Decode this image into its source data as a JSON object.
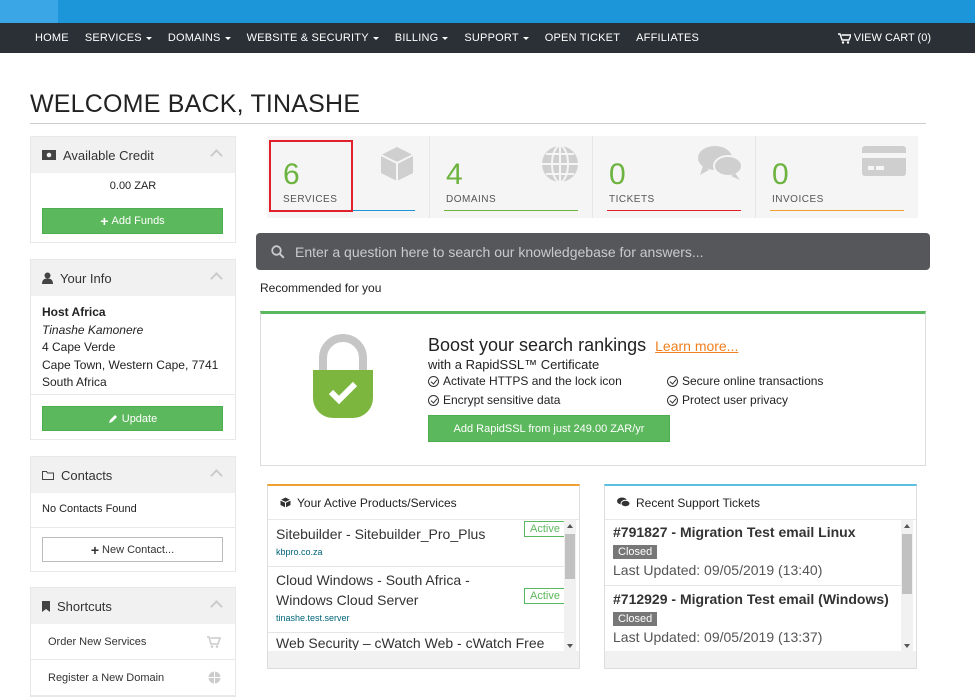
{
  "nav": {
    "items": [
      {
        "label": "HOME",
        "caret": false
      },
      {
        "label": "SERVICES",
        "caret": true
      },
      {
        "label": "DOMAINS",
        "caret": true
      },
      {
        "label": "WEBSITE & SECURITY",
        "caret": true
      },
      {
        "label": "BILLING",
        "caret": true
      },
      {
        "label": "SUPPORT",
        "caret": true
      },
      {
        "label": "OPEN TICKET",
        "caret": false
      },
      {
        "label": "AFFILIATES",
        "caret": false
      }
    ],
    "cart_label": "VIEW CART (0)"
  },
  "page_title": "WELCOME BACK, TINASHE",
  "sidebar": {
    "credit": {
      "title": "Available Credit",
      "amount": "0.00 ZAR",
      "button": "Add Funds"
    },
    "info": {
      "title": "Your Info",
      "company": "Host Africa",
      "name": "Tinashe Kamonere",
      "address1": "4 Cape Verde",
      "address2": "Cape Town, Western Cape, 7741",
      "country": "South Africa",
      "button": "Update"
    },
    "contacts": {
      "title": "Contacts",
      "empty": "No Contacts Found",
      "button": "New Contact..."
    },
    "shortcuts": {
      "title": "Shortcuts",
      "items": [
        "Order New Services",
        "Register a New Domain"
      ]
    }
  },
  "stats": [
    {
      "value": "6",
      "label": "SERVICES",
      "color": "#1c95d9",
      "icon": "cube-icon"
    },
    {
      "value": "4",
      "label": "DOMAINS",
      "color": "#6cb33f",
      "icon": "globe-icon"
    },
    {
      "value": "0",
      "label": "TICKETS",
      "color": "#e0202a",
      "icon": "chat-bubbles-icon"
    },
    {
      "value": "0",
      "label": "INVOICES",
      "color": "#f0a030",
      "icon": "credit-card-icon"
    }
  ],
  "search": {
    "placeholder": "Enter a question here to search our knowledgebase for answers..."
  },
  "recommended": {
    "label": "Recommended for you",
    "title": "Boost your search rankings",
    "link": "Learn more...",
    "subtitle": "with a RapidSSL™ Certificate",
    "features": [
      "Activate HTTPS and the lock icon",
      "Secure online transactions",
      "Encrypt sensitive data",
      "Protect user privacy"
    ],
    "cta": "Add RapidSSL from just 249.00 ZAR/yr"
  },
  "products": {
    "title": "Your Active Products/Services",
    "items": [
      {
        "name": "Sitebuilder - Sitebuilder_Pro_Plus",
        "domain": "kbpro.co.za",
        "status": "Active"
      },
      {
        "name": "Cloud Windows - South Africa - Windows Cloud Server",
        "domain": "tinashe.test.server",
        "status": "Active"
      },
      {
        "name": "Web Security – cWatch Web - cWatch Free"
      }
    ]
  },
  "tickets": {
    "title": "Recent Support Tickets",
    "items": [
      {
        "title": "#791827 - Migration Test email Linux",
        "status": "Closed",
        "updated": "Last Updated: 09/05/2019 (13:40)"
      },
      {
        "title": "#712929 - Migration Test email (Windows)",
        "status": "Closed",
        "updated": "Last Updated: 09/05/2019 (13:37)"
      }
    ]
  }
}
